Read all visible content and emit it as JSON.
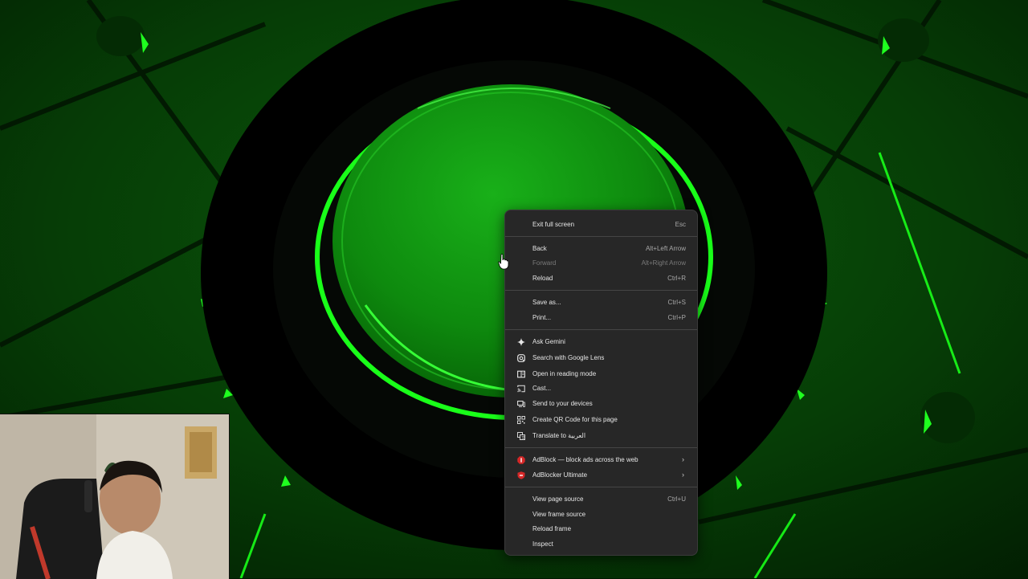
{
  "colors": {
    "accent_green": "#19ff19",
    "menu_bg": "#272727",
    "menu_text": "#e6e6e6",
    "shortcut_text": "#a8a8a8",
    "adblock_red": "#d62828"
  },
  "context_menu": {
    "items": [
      {
        "label": "Exit full screen",
        "shortcut": "Esc"
      },
      {
        "label": "Back",
        "shortcut": "Alt+Left Arrow"
      },
      {
        "label": "Forward",
        "shortcut": "Alt+Right Arrow"
      },
      {
        "label": "Reload",
        "shortcut": "Ctrl+R"
      },
      {
        "label": "Save as...",
        "shortcut": "Ctrl+S"
      },
      {
        "label": "Print...",
        "shortcut": "Ctrl+P"
      },
      {
        "label": "Ask Gemini",
        "icon": "gemini-sparkle-icon"
      },
      {
        "label": "Search with Google Lens",
        "icon": "google-lens-icon"
      },
      {
        "label": "Open in reading mode",
        "icon": "reading-mode-icon"
      },
      {
        "label": "Cast...",
        "icon": "cast-icon"
      },
      {
        "label": "Send to your devices",
        "icon": "send-to-devices-icon"
      },
      {
        "label": "Create QR Code for this page",
        "icon": "qr-code-icon"
      },
      {
        "label": "Translate to العربية",
        "icon": "translate-icon"
      },
      {
        "label": "AdBlock — block ads across the web",
        "icon": "adblock-icon"
      },
      {
        "label": "AdBlocker Ultimate",
        "icon": "adblocker-ultimate-icon"
      },
      {
        "label": "View page source",
        "shortcut": "Ctrl+U"
      },
      {
        "label": "View frame source"
      },
      {
        "label": "Reload frame"
      },
      {
        "label": "Inspect"
      }
    ]
  }
}
